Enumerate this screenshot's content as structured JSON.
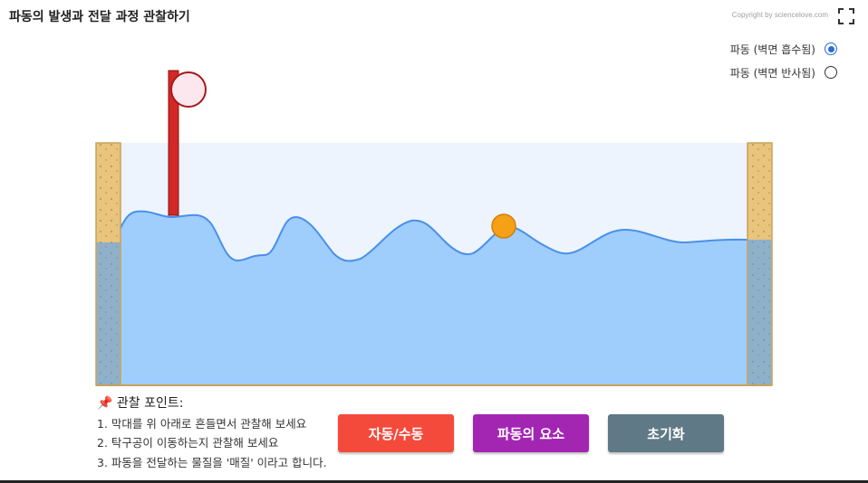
{
  "header": {
    "title": "파동의 발생과 전달 과정 관찰하기",
    "copyright": "Copyright by sciencelove.com"
  },
  "modes": [
    {
      "label": "파동 (벽면 흡수됨)",
      "selected": true
    },
    {
      "label": "파동 (벽면 반사됨)",
      "selected": false
    }
  ],
  "observation": {
    "heading": "관찰 포인트:",
    "items": [
      "1. 막대를 위 아래로 흔들면서 관찰해 보세요",
      "2. 탁구공이 이동하는지 관찰해 보세요",
      "3. 파동을 전달하는 물질을 '매질' 이라고 합니다."
    ]
  },
  "buttons": {
    "auto_manual": "자동/수동",
    "wave_elements": "파동의 요소",
    "reset": "초기화"
  },
  "colors": {
    "water": "#9fcdfc",
    "wave_line": "#4a90e8",
    "sky": "#edf4fe",
    "sand": "#e8c47c",
    "rod": "#d32828",
    "ball": "#f5a017",
    "btn_auto": "#f44a3c",
    "btn_elements": "#a326b3",
    "btn_reset": "#5f7986"
  },
  "icons": {
    "fullscreen": "fullscreen-icon",
    "pin": "pin-icon"
  }
}
